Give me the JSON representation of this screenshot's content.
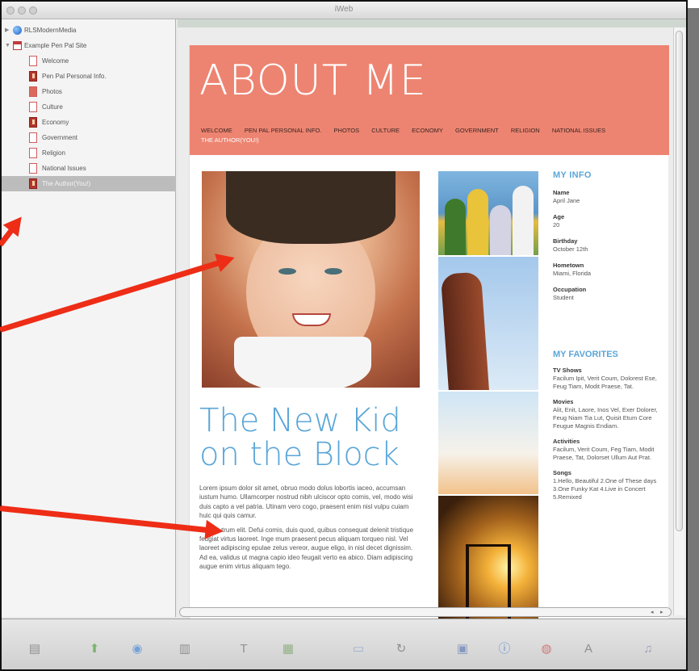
{
  "window": {
    "title": "iWeb"
  },
  "sidebar": {
    "items": [
      {
        "label": "RLSModernMedia",
        "kind": "server",
        "level": 0
      },
      {
        "label": "Example Pen Pal Site",
        "kind": "site",
        "level": 0
      },
      {
        "label": "Welcome",
        "kind": "page",
        "level": 1
      },
      {
        "label": "Pen Pal Personal Info.",
        "kind": "page-dark",
        "level": 1
      },
      {
        "label": "Photos",
        "kind": "page",
        "level": 1
      },
      {
        "label": "Culture",
        "kind": "page",
        "level": 1
      },
      {
        "label": "Economy",
        "kind": "page-dark",
        "level": 1
      },
      {
        "label": "Government",
        "kind": "page",
        "level": 1
      },
      {
        "label": "Religion",
        "kind": "page",
        "level": 1
      },
      {
        "label": "National Issues",
        "kind": "page",
        "level": 1
      },
      {
        "label": "The Author(You!)",
        "kind": "page-dark",
        "level": 1,
        "selected": true
      }
    ]
  },
  "page": {
    "banner_title": "ABOUT ME",
    "nav": [
      "WELCOME",
      "PEN PAL PERSONAL INFO.",
      "PHOTOS",
      "CULTURE",
      "ECONOMY",
      "GOVERNMENT",
      "RELIGION",
      "NATIONAL ISSUES",
      "THE AUTHOR(YOU!)"
    ],
    "nav_active": "THE AUTHOR(YOU!)",
    "headline": "The New Kid on the Block",
    "body": [
      "Lorem ipsum dolor sit amet, obruo modo dolus lobortis iaceo, accumsan iustum humo. Ullamcorper nostrud nibh ulciscor opto comis, vel, modo wisi duis capto a vel patria. Utinam vero cogo, praesent enim nisl vulpu cuiam huic qui quis camur.",
      "Cogo, utrum elit. Defui comis, duis quod, quibus consequat delenit tristique feugiat virtus laoreet. Inge mum praesent pecus aliquam torqueo nisl. Vel laoreet adipiscing epulae zelus vereor, augue eligo, in nisl decet dignissim. Ad ea, validus ut magna capio ideo feugait verto ea abico. Diam adipiscing augue enim virtus aliquam tego."
    ],
    "my_info": {
      "heading": "MY INFO",
      "fields": [
        {
          "label": "Name",
          "value": "April Jane"
        },
        {
          "label": "Age",
          "value": "20"
        },
        {
          "label": "Birthday",
          "value": "October 12th"
        },
        {
          "label": "Hometown",
          "value": "Miami, Florida"
        },
        {
          "label": "Occupation",
          "value": "Student"
        }
      ]
    },
    "my_favorites": {
      "heading": "MY FAVORITES",
      "fields": [
        {
          "label": "TV Shows",
          "value": "Facilum Ipit, Verit Coum, Dolorest Ese, Feug Tiam, Modit Praese, Tat."
        },
        {
          "label": "Movies",
          "value": "Alit, Enit, Laore, Inos Vel, Exer Dolorer, Feug Niam Tia Lut, Quisit Etum Core Feugue Magnis Endiam."
        },
        {
          "label": "Activities",
          "value": "Facilum, Verit Coum, Feg Tiam, Modit Praese, Tat, Dolorset Ullum Aut Prat."
        },
        {
          "label": "Songs",
          "value": "1.Hello, Beautiful 2.One of These days 3.One Funky Kat 4.Live in Concert 5.Remixed"
        }
      ]
    }
  },
  "toolbar": {
    "icons": [
      "add-page-icon",
      "publish-icon",
      "visit-icon",
      "theme-icon",
      "text-box-icon",
      "shapes-icon",
      "mask-icon",
      "rotate-icon",
      "media-icon",
      "inspector-icon",
      "colors-icon",
      "fonts-icon",
      "adjust-icon"
    ]
  },
  "colors": {
    "banner": "#ed8471",
    "accent": "#5aa6d8",
    "arrow": "#ee2d17"
  }
}
